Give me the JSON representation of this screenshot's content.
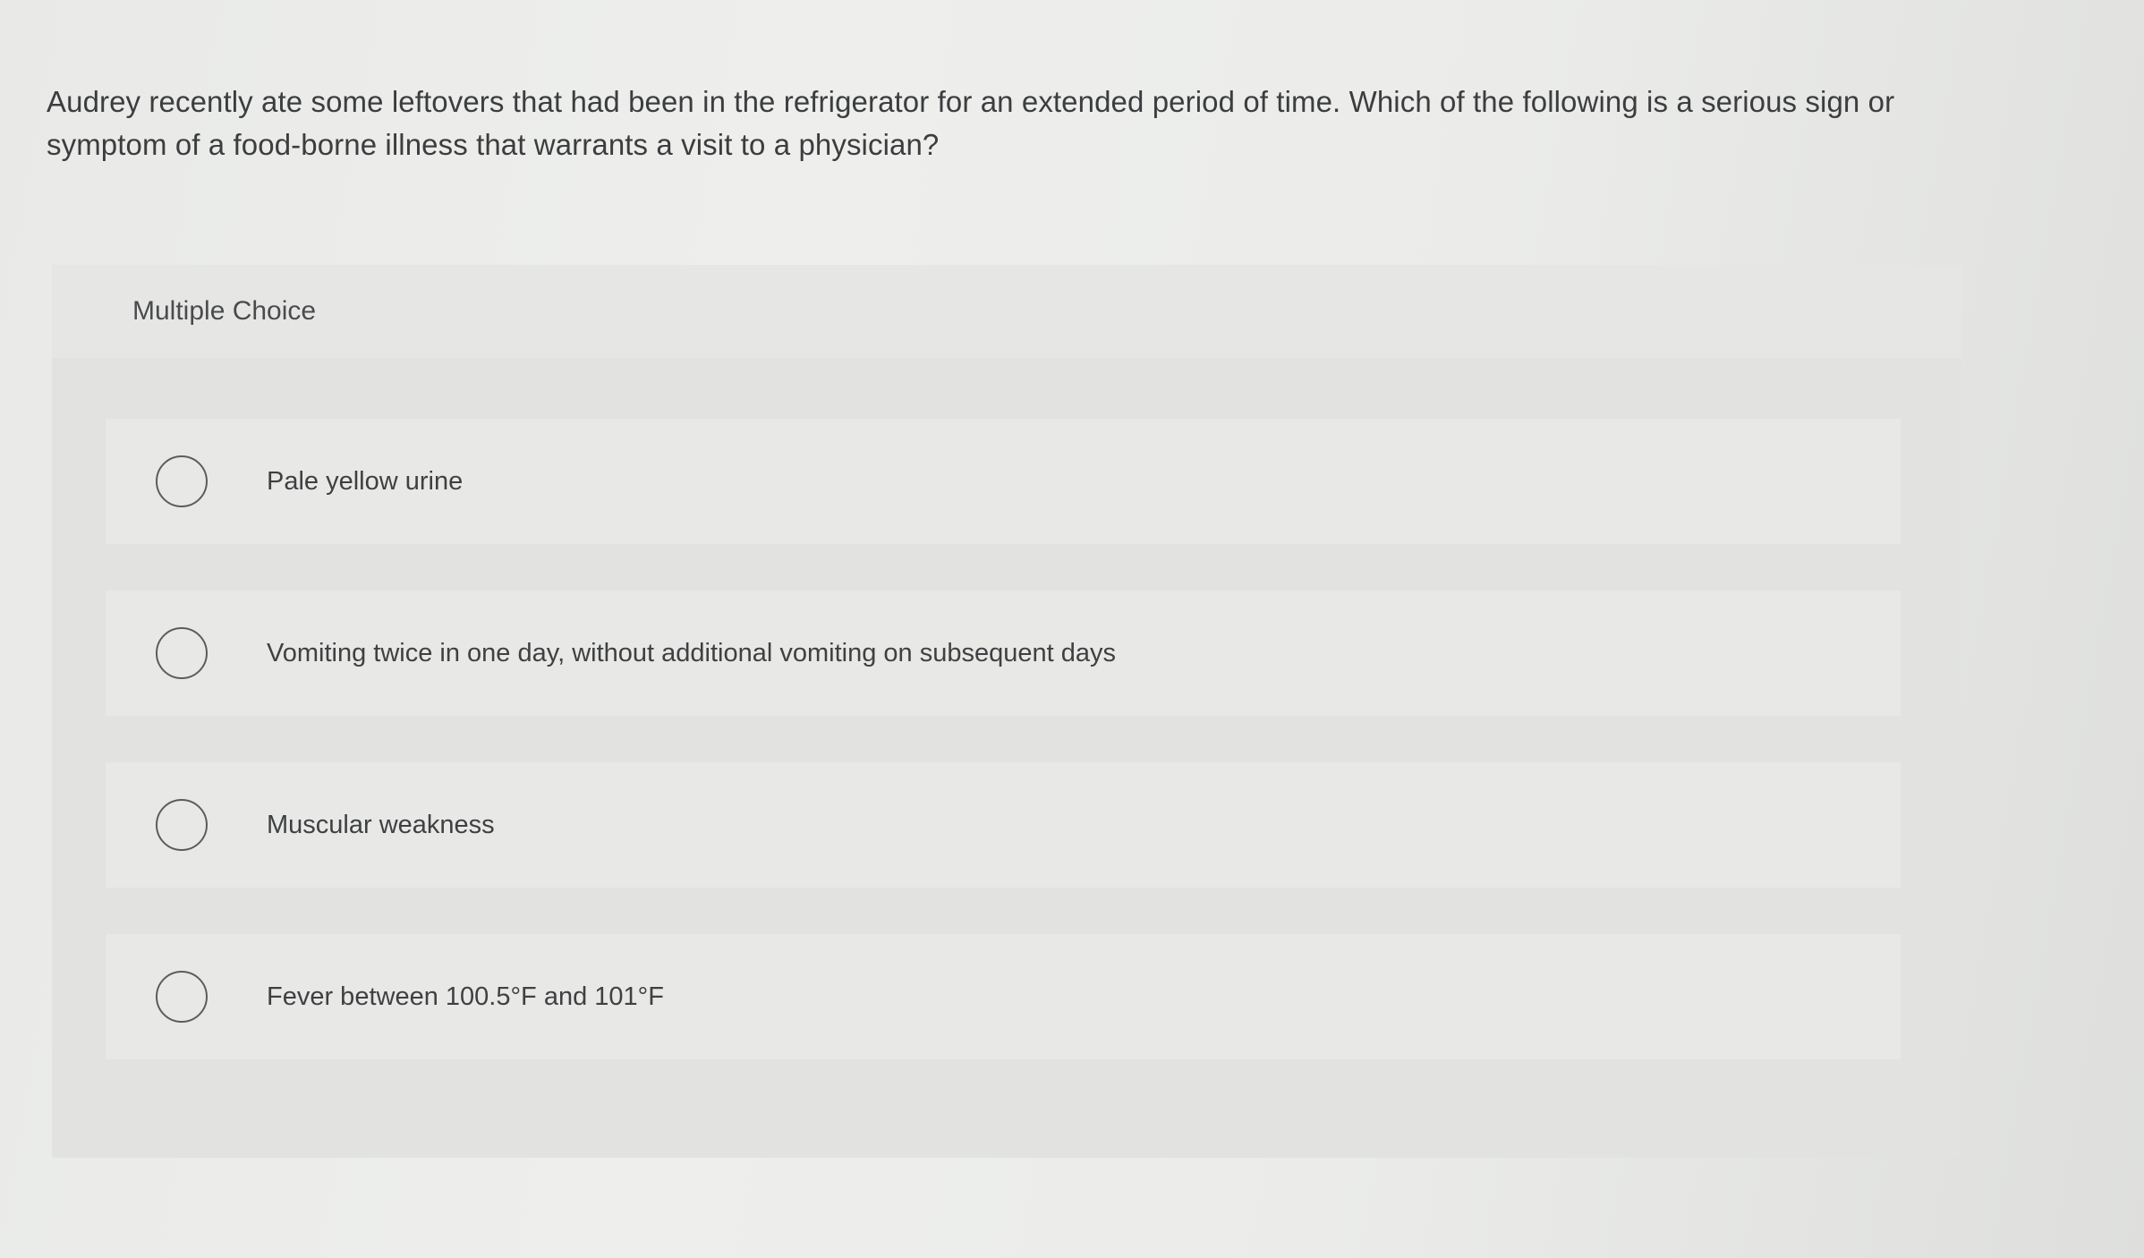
{
  "question": {
    "text": "Audrey recently ate some leftovers that had been in the refrigerator for an extended period of time. Which of the following is a serious sign or symptom of a food-borne illness that warrants a visit to a physician?"
  },
  "multiple_choice": {
    "header": "Multiple Choice",
    "options": [
      {
        "label": "Pale yellow urine",
        "selected": false
      },
      {
        "label": "Vomiting twice in one day, without additional vomiting on subsequent days",
        "selected": false
      },
      {
        "label": "Muscular weakness",
        "selected": false
      },
      {
        "label": "Fever between 100.5°F and 101°F",
        "selected": false
      }
    ]
  }
}
